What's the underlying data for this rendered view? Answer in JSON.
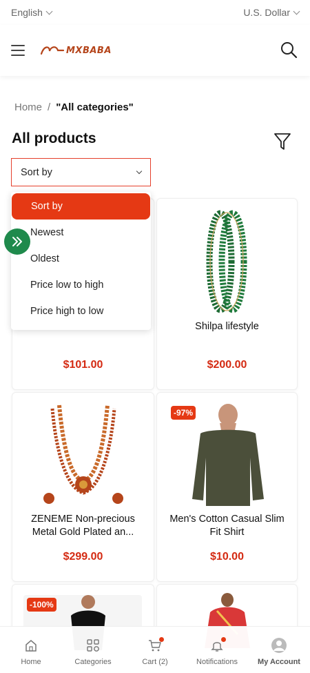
{
  "topbar": {
    "language": "English",
    "currency": "U.S. Dollar"
  },
  "header": {
    "logo_text": "MXBABA"
  },
  "breadcrumb": {
    "home": "Home",
    "separator": "/",
    "current": "\"All categories\""
  },
  "page": {
    "title": "All products"
  },
  "sort": {
    "label": "Sort by",
    "options": [
      "Sort by",
      "Newest",
      "Oldest",
      "Price low to high",
      "Price high to low"
    ],
    "selected_index": 0
  },
  "products": [
    {
      "name": "",
      "price": "$101.00",
      "badge": ""
    },
    {
      "name": "Shilpa lifestyle",
      "price": "$200.00",
      "badge": ""
    },
    {
      "name": "ZENEME Non-precious Metal Gold Plated an...",
      "price": "$299.00",
      "badge": ""
    },
    {
      "name": "Men's Cotton Casual Slim Fit Shirt",
      "price": "$10.00",
      "badge": "-97%"
    },
    {
      "name": "",
      "price": "",
      "badge": "-100%"
    },
    {
      "name": "",
      "price": "",
      "badge": ""
    }
  ],
  "bottom_nav": [
    {
      "label": "Home",
      "icon": "home-icon"
    },
    {
      "label": "Categories",
      "icon": "categories-icon"
    },
    {
      "label": "Cart (2)",
      "icon": "cart-icon"
    },
    {
      "label": "Notifications",
      "icon": "bell-icon"
    },
    {
      "label": "My Account",
      "icon": "account-icon"
    }
  ],
  "colors": {
    "accent": "#e53914",
    "price": "#d42a12",
    "float_button": "#1f8a4c",
    "brand": "#b5451b"
  }
}
